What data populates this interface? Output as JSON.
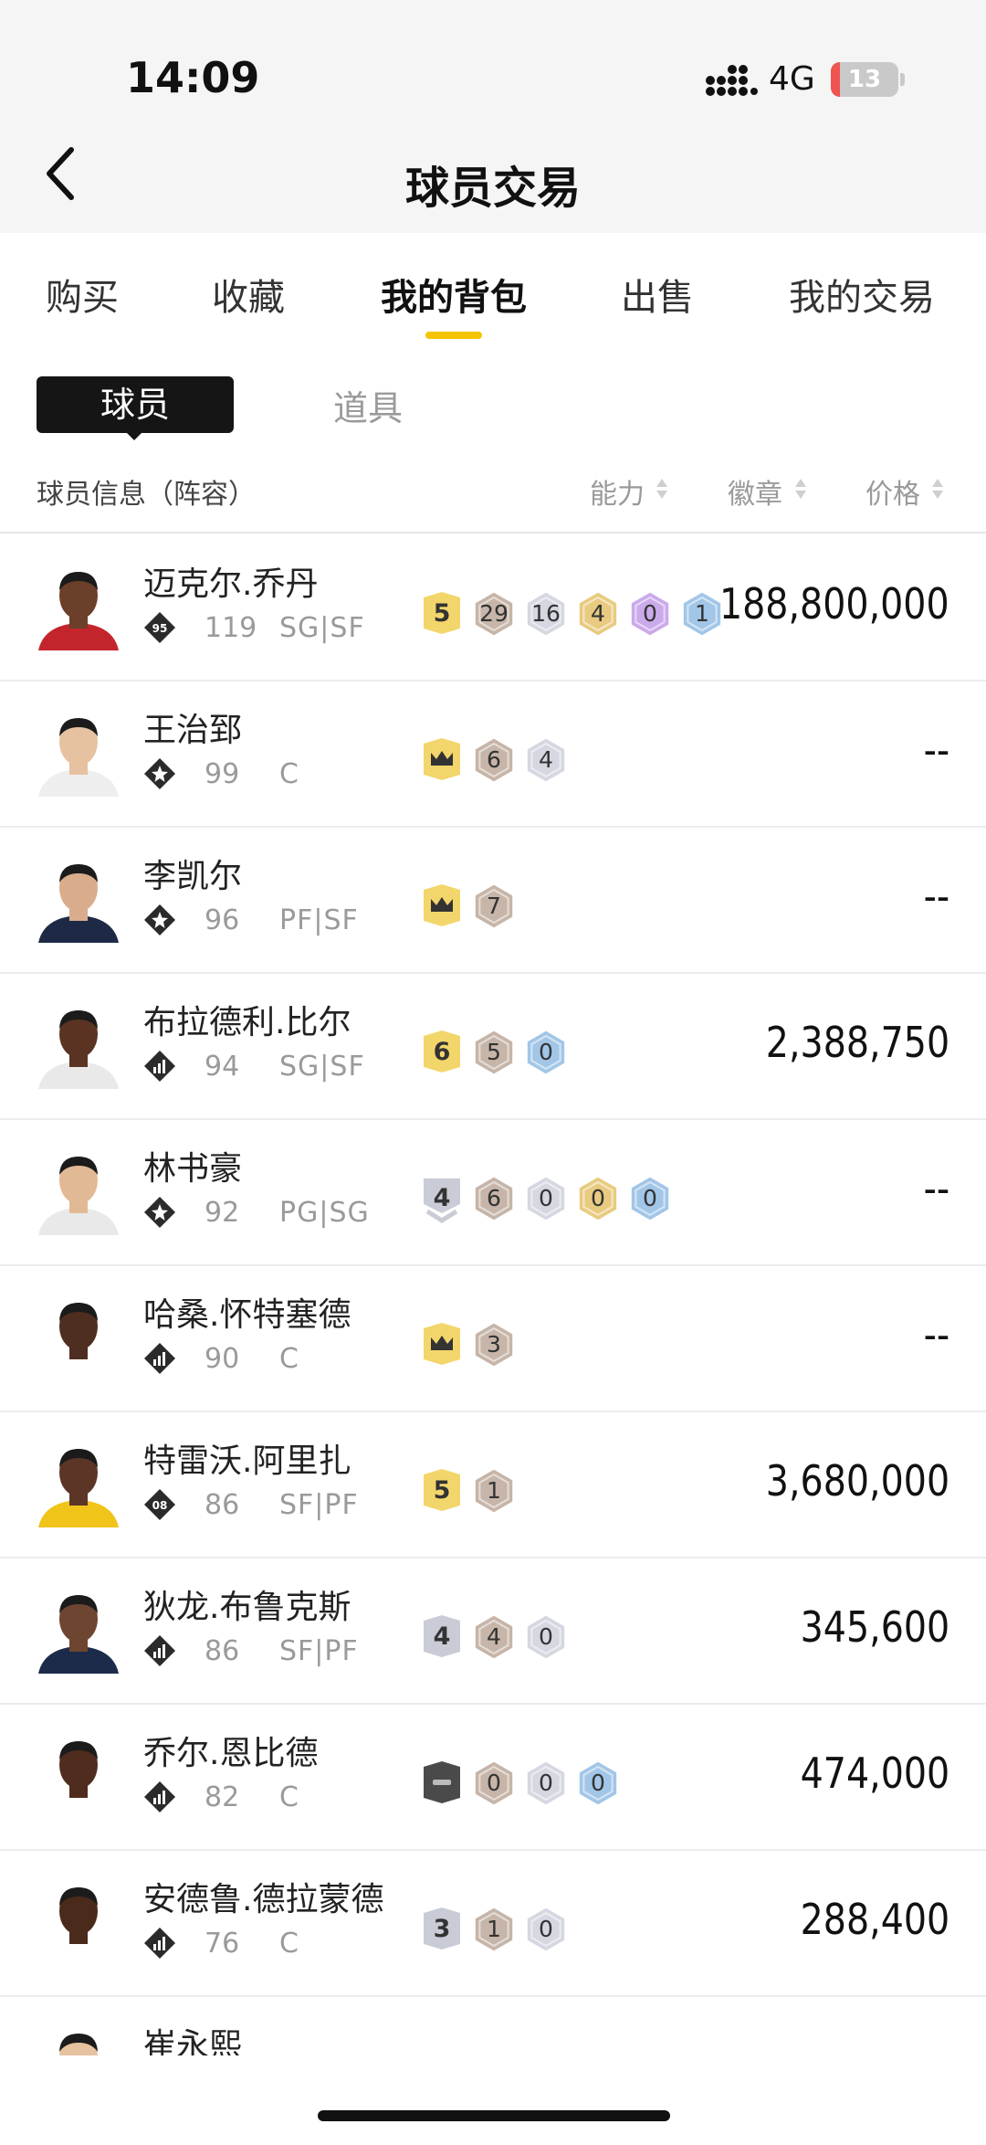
{
  "status_bar": {
    "time": "14:09",
    "network": "4G",
    "battery": "13",
    "battery_level": 0.13
  },
  "nav": {
    "title": "球员交易"
  },
  "tabs": [
    "购买",
    "收藏",
    "我的背包",
    "出售",
    "我的交易"
  ],
  "active_tab": 2,
  "subtabs": {
    "player": "球员",
    "item": "道具"
  },
  "header": {
    "info": "球员信息（阵容）",
    "ability": "能力",
    "badge": "徽章",
    "price": "价格"
  },
  "colors": {
    "accent": "#f5c400",
    "badge_gold_tier": "#f3d66b",
    "badge_silver_tier": "#c9ccd6",
    "badge_dark_tier": "#4a4a4a",
    "badge_bronze": "#c4b2a4",
    "badge_silver": "#d3d6e0",
    "badge_gold": "#e7c97a",
    "badge_purple": "#c9a6ea",
    "badge_blue": "#9ec3e6"
  },
  "players": [
    {
      "name": "迈克尔.乔丹",
      "level_icon": "rank-95-icon",
      "level_label": "95",
      "ovr": "119",
      "pos": "SG|SF",
      "price": "188,800,000",
      "badges": [
        {
          "tier": "gold",
          "label": "5"
        },
        {
          "kind": "bronze",
          "label": "29"
        },
        {
          "kind": "silver",
          "label": "16"
        },
        {
          "kind": "gold",
          "label": "4"
        },
        {
          "kind": "purple",
          "label": "0"
        },
        {
          "kind": "blue",
          "label": "1"
        }
      ]
    },
    {
      "name": "王治郅",
      "level_icon": "star-rank-icon",
      "level_label": "",
      "ovr": "99",
      "pos": "C",
      "price": "--",
      "badges": [
        {
          "tier": "gold",
          "label": "",
          "crown": true
        },
        {
          "kind": "bronze",
          "label": "6"
        },
        {
          "kind": "silver",
          "label": "4"
        }
      ]
    },
    {
      "name": "李凯尔",
      "level_icon": "star-rank-icon",
      "level_label": "",
      "ovr": "96",
      "pos": "PF|SF",
      "price": "--",
      "badges": [
        {
          "tier": "gold",
          "label": "",
          "crown": true
        },
        {
          "kind": "bronze",
          "label": "7"
        }
      ]
    },
    {
      "name": "布拉德利.比尔",
      "level_icon": "bars-rank-icon",
      "level_label": "",
      "ovr": "94",
      "pos": "SG|SF",
      "price": "2,388,750",
      "badges": [
        {
          "tier": "gold",
          "label": "6"
        },
        {
          "kind": "bronze",
          "label": "5"
        },
        {
          "kind": "blue",
          "label": "0"
        }
      ]
    },
    {
      "name": "林书豪",
      "level_icon": "star-rank-icon",
      "level_label": "",
      "ovr": "92",
      "pos": "PG|SG",
      "price": "--",
      "badges": [
        {
          "tier": "silver-chevron",
          "label": "4"
        },
        {
          "kind": "bronze",
          "label": "6"
        },
        {
          "kind": "silver",
          "label": "0"
        },
        {
          "kind": "gold",
          "label": "0"
        },
        {
          "kind": "blue",
          "label": "0"
        }
      ]
    },
    {
      "name": "哈桑.怀特塞德",
      "level_icon": "bars-rank-icon",
      "level_label": "",
      "ovr": "90",
      "pos": "C",
      "price": "--",
      "badges": [
        {
          "tier": "gold",
          "label": "",
          "crown": true
        },
        {
          "kind": "bronze",
          "label": "3"
        }
      ]
    },
    {
      "name": "特雷沃.阿里扎",
      "level_icon": "rank-08-icon",
      "level_label": "08",
      "ovr": "86",
      "pos": "SF|PF",
      "price": "3,680,000",
      "badges": [
        {
          "tier": "gold",
          "label": "5"
        },
        {
          "kind": "bronze",
          "label": "1"
        }
      ]
    },
    {
      "name": "狄龙.布鲁克斯",
      "level_icon": "bars-rank-icon",
      "level_label": "",
      "ovr": "86",
      "pos": "SF|PF",
      "price": "345,600",
      "badges": [
        {
          "tier": "silver",
          "label": "4"
        },
        {
          "kind": "bronze",
          "label": "4"
        },
        {
          "kind": "silver",
          "label": "0"
        }
      ]
    },
    {
      "name": "乔尔.恩比德",
      "level_icon": "bars-rank-icon",
      "level_label": "",
      "ovr": "82",
      "pos": "C",
      "price": "474,000",
      "badges": [
        {
          "tier": "dark",
          "label": "",
          "dash": true
        },
        {
          "kind": "bronze",
          "label": "0"
        },
        {
          "kind": "silver",
          "label": "0"
        },
        {
          "kind": "blue",
          "label": "0"
        }
      ]
    },
    {
      "name": "安德鲁.德拉蒙德",
      "level_icon": "bars-rank-icon",
      "level_label": "",
      "ovr": "76",
      "pos": "C",
      "price": "288,400",
      "badges": [
        {
          "tier": "silver",
          "label": "3"
        },
        {
          "kind": "bronze",
          "label": "1"
        },
        {
          "kind": "silver",
          "label": "0"
        }
      ]
    },
    {
      "name": "崔永熙",
      "level_icon": "bars-rank-icon",
      "level_label": "",
      "ovr": "",
      "pos": "",
      "price": "",
      "badges": []
    }
  ]
}
